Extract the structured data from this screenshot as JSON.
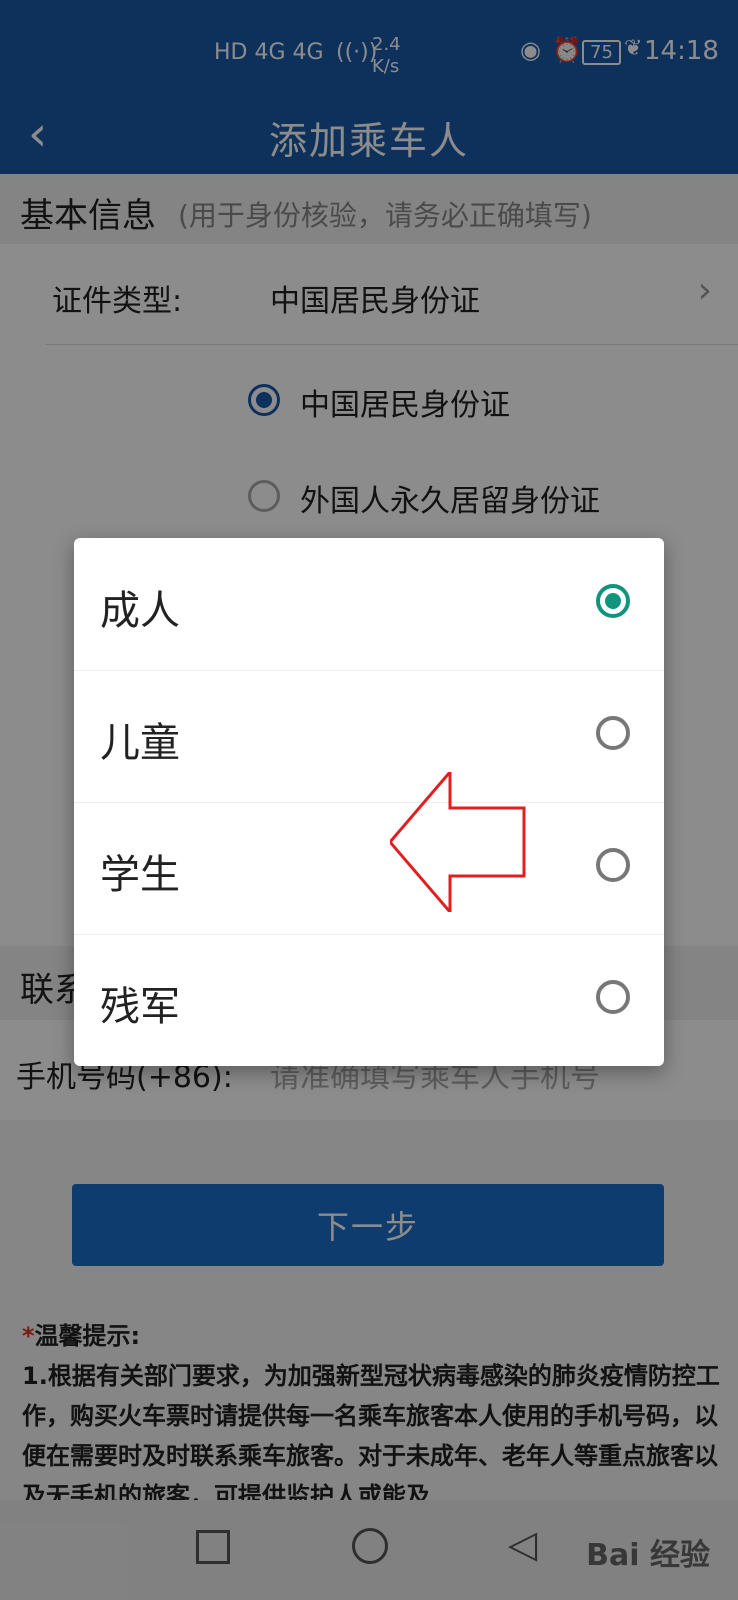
{
  "status_bar": {
    "network": "HD 4G 4G",
    "speed_value": "2.4",
    "speed_unit": "K/s",
    "battery": "75",
    "time": "14:18"
  },
  "header": {
    "title": "添加乘车人"
  },
  "basic_info": {
    "title": "基本信息",
    "subtitle": "(用于身份核验，请务必正确填写)"
  },
  "id_type": {
    "label": "证件类型:",
    "value": "中国居民身份证",
    "options": [
      "中国居民身份证",
      "外国人永久居留身份证"
    ]
  },
  "contact": {
    "title": "联系"
  },
  "phone": {
    "label": "手机号码(+86):",
    "placeholder": "请准确填写乘车人手机号"
  },
  "next_button": {
    "label": "下一步"
  },
  "tips": {
    "required_mark": "*",
    "title": "温馨提示:",
    "body": "1.根据有关部门要求，为加强新型冠状病毒感染的肺炎疫情防控工作，购买火车票时请提供每一名乘车旅客本人使用的手机号码，以便在需要时及时联系乘车旅客。对于未成年、老年人等重点旅客以及无手机的旅客，可提供监护人或能及"
  },
  "dialog": {
    "options": [
      {
        "label": "成人",
        "selected": true
      },
      {
        "label": "儿童",
        "selected": false
      },
      {
        "label": "学生",
        "selected": false
      },
      {
        "label": "残军",
        "selected": false
      }
    ]
  },
  "watermark": "Bai 经验",
  "colors": {
    "header_bg": "#1b5aa8",
    "button_bg": "#1b6dc9",
    "radio_selected": "#11947d",
    "arrow": "#e02020"
  }
}
